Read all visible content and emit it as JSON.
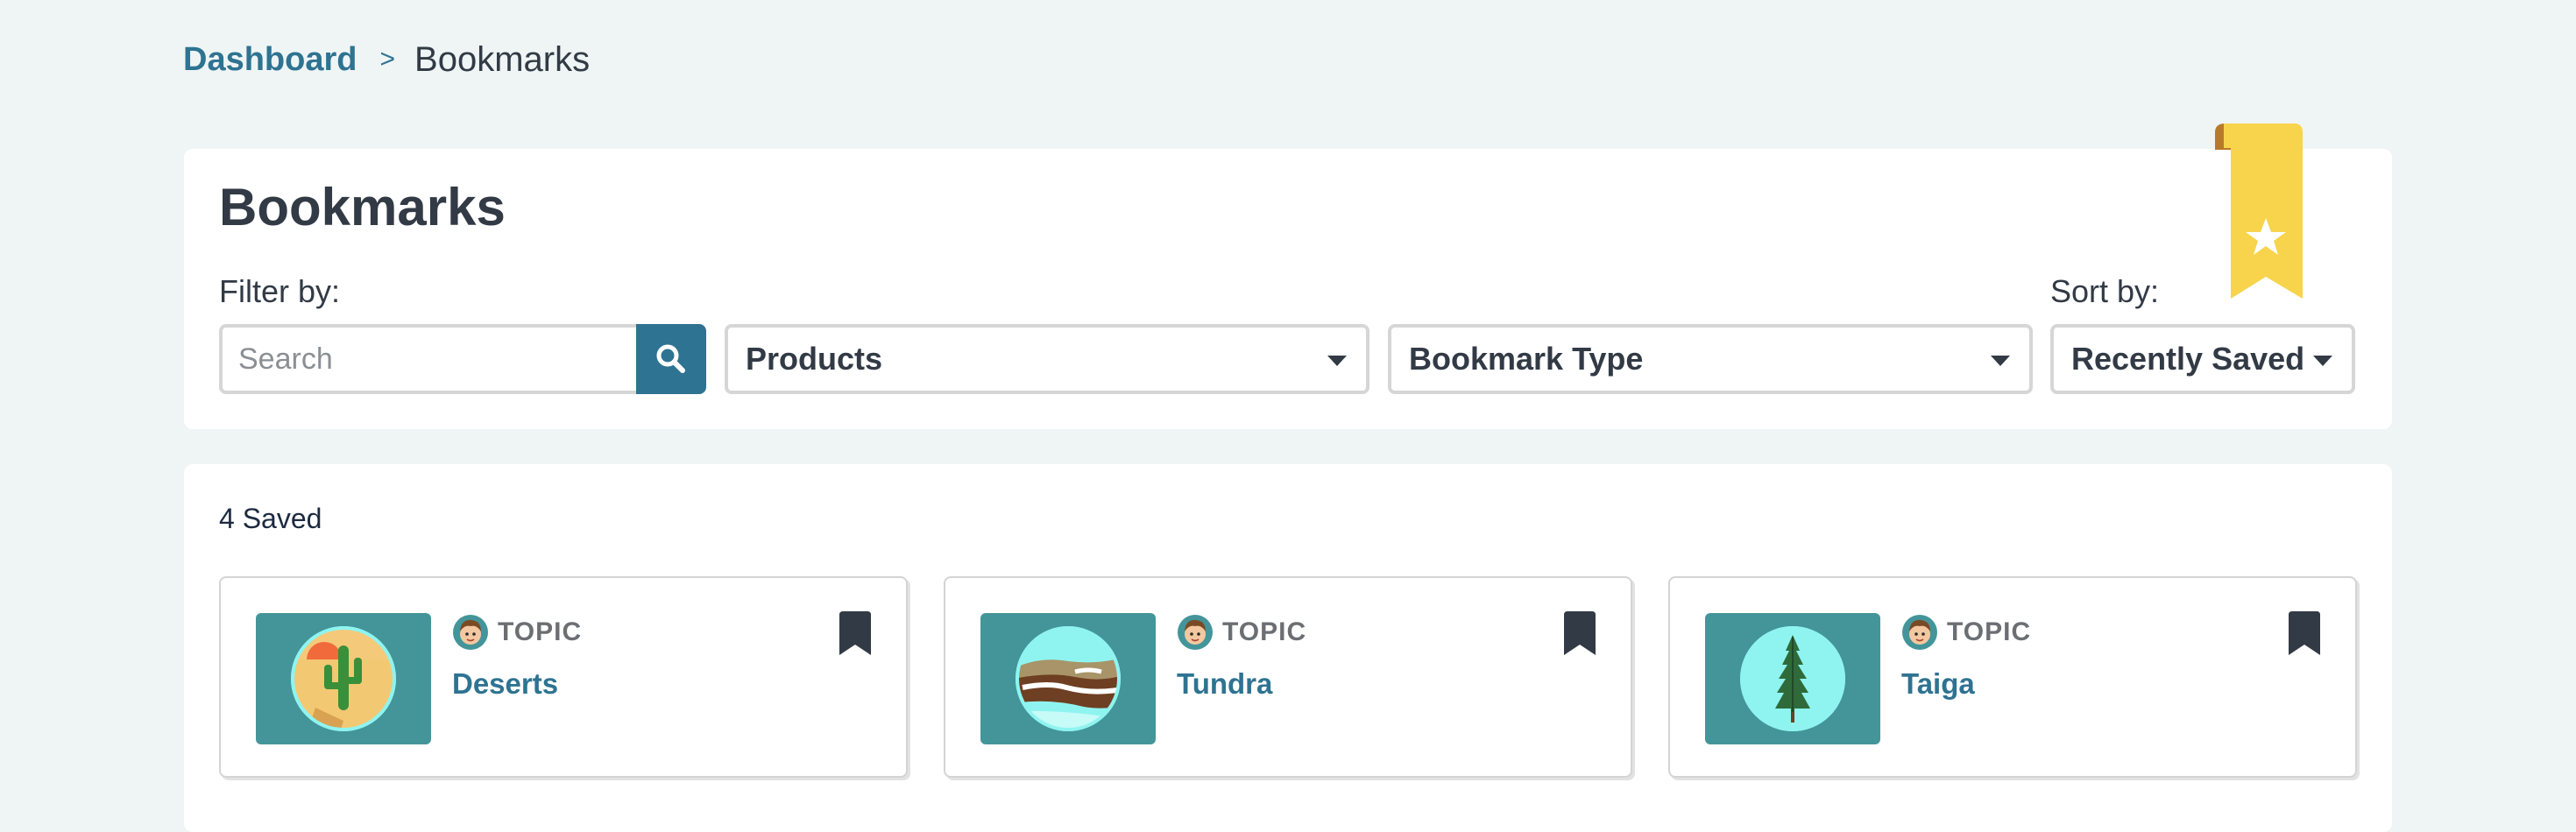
{
  "breadcrumb": {
    "dashboard": "Dashboard",
    "separator": ">",
    "current": "Bookmarks"
  },
  "header": {
    "title": "Bookmarks",
    "ribbon_icon": "bookmark-ribbon-star-icon"
  },
  "filters": {
    "filter_label": "Filter by:",
    "search_placeholder": "Search",
    "search_icon": "search-icon",
    "products_label": "Products",
    "bookmark_type_label": "Bookmark Type",
    "sort_label": "Sort by:",
    "sort_value": "Recently Saved"
  },
  "results": {
    "count_label": "4 Saved",
    "cards": [
      {
        "type_label": "TOPIC",
        "title": "Deserts",
        "image_icon": "desert-cactus-icon"
      },
      {
        "type_label": "TOPIC",
        "title": "Tundra",
        "image_icon": "tundra-landscape-icon"
      },
      {
        "type_label": "TOPIC",
        "title": "Taiga",
        "image_icon": "taiga-tree-icon"
      }
    ]
  },
  "colors": {
    "background": "#eff5f5",
    "accent": "#2e7391",
    "thumb_bg": "#43959a",
    "ribbon": "#f7d44c"
  }
}
